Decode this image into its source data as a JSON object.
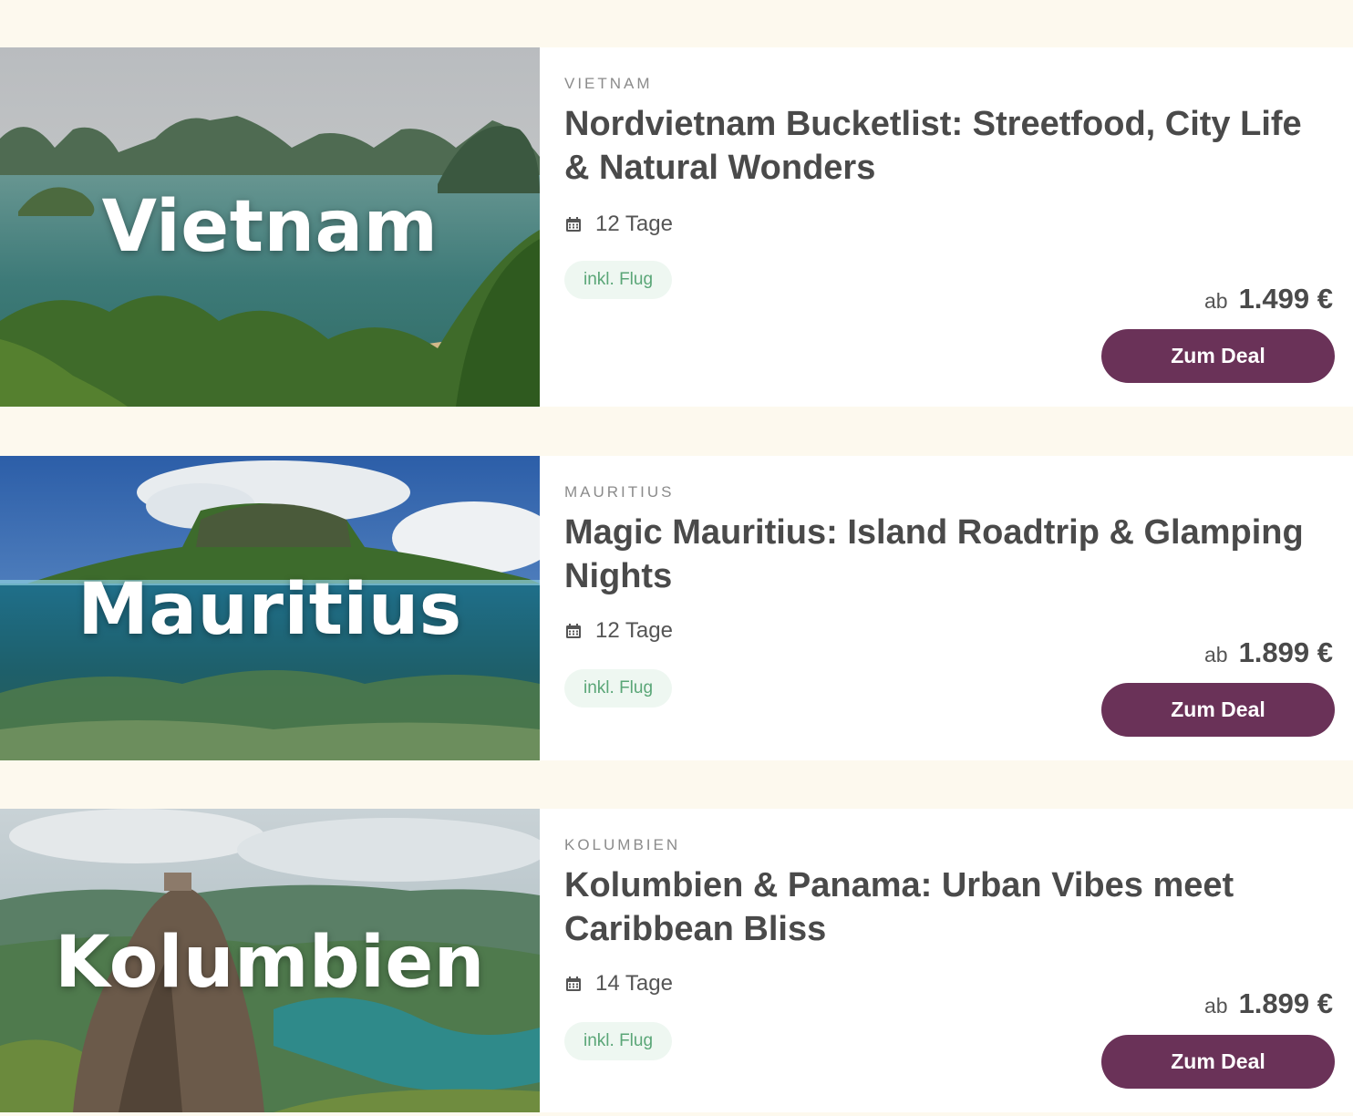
{
  "colors": {
    "page_background": "#fdf9ee",
    "title_text": "#4a4a4a",
    "badge_background": "#eef7f1",
    "badge_text": "#5aa677",
    "button_background": "#6a3258",
    "button_text": "#ffffff"
  },
  "deals": [
    {
      "image_label": "Vietnam",
      "country": "VIETNAM",
      "title": "Nordvietnam Bucketlist: Streetfood, City Life & Natural Wonders",
      "duration_icon": "calendar-icon",
      "duration": "12 Tage",
      "badge": "inkl. Flug",
      "price_prefix": "ab",
      "price": "1.499 €",
      "button_label": "Zum Deal"
    },
    {
      "image_label": "Mauritius",
      "country": "MAURITIUS",
      "title": "Magic Mauritius: Island Roadtrip & Glamping Nights",
      "duration_icon": "calendar-icon",
      "duration": "12 Tage",
      "badge": "inkl. Flug",
      "price_prefix": "ab",
      "price": "1.899 €",
      "button_label": "Zum Deal"
    },
    {
      "image_label": "Kolumbien",
      "country": "KOLUMBIEN",
      "title": "Kolumbien & Panama: Urban Vibes meet Caribbean Bliss",
      "duration_icon": "calendar-icon",
      "duration": "14 Tage",
      "badge": "inkl. Flug",
      "price_prefix": "ab",
      "price": "1.899 €",
      "button_label": "Zum Deal"
    }
  ]
}
